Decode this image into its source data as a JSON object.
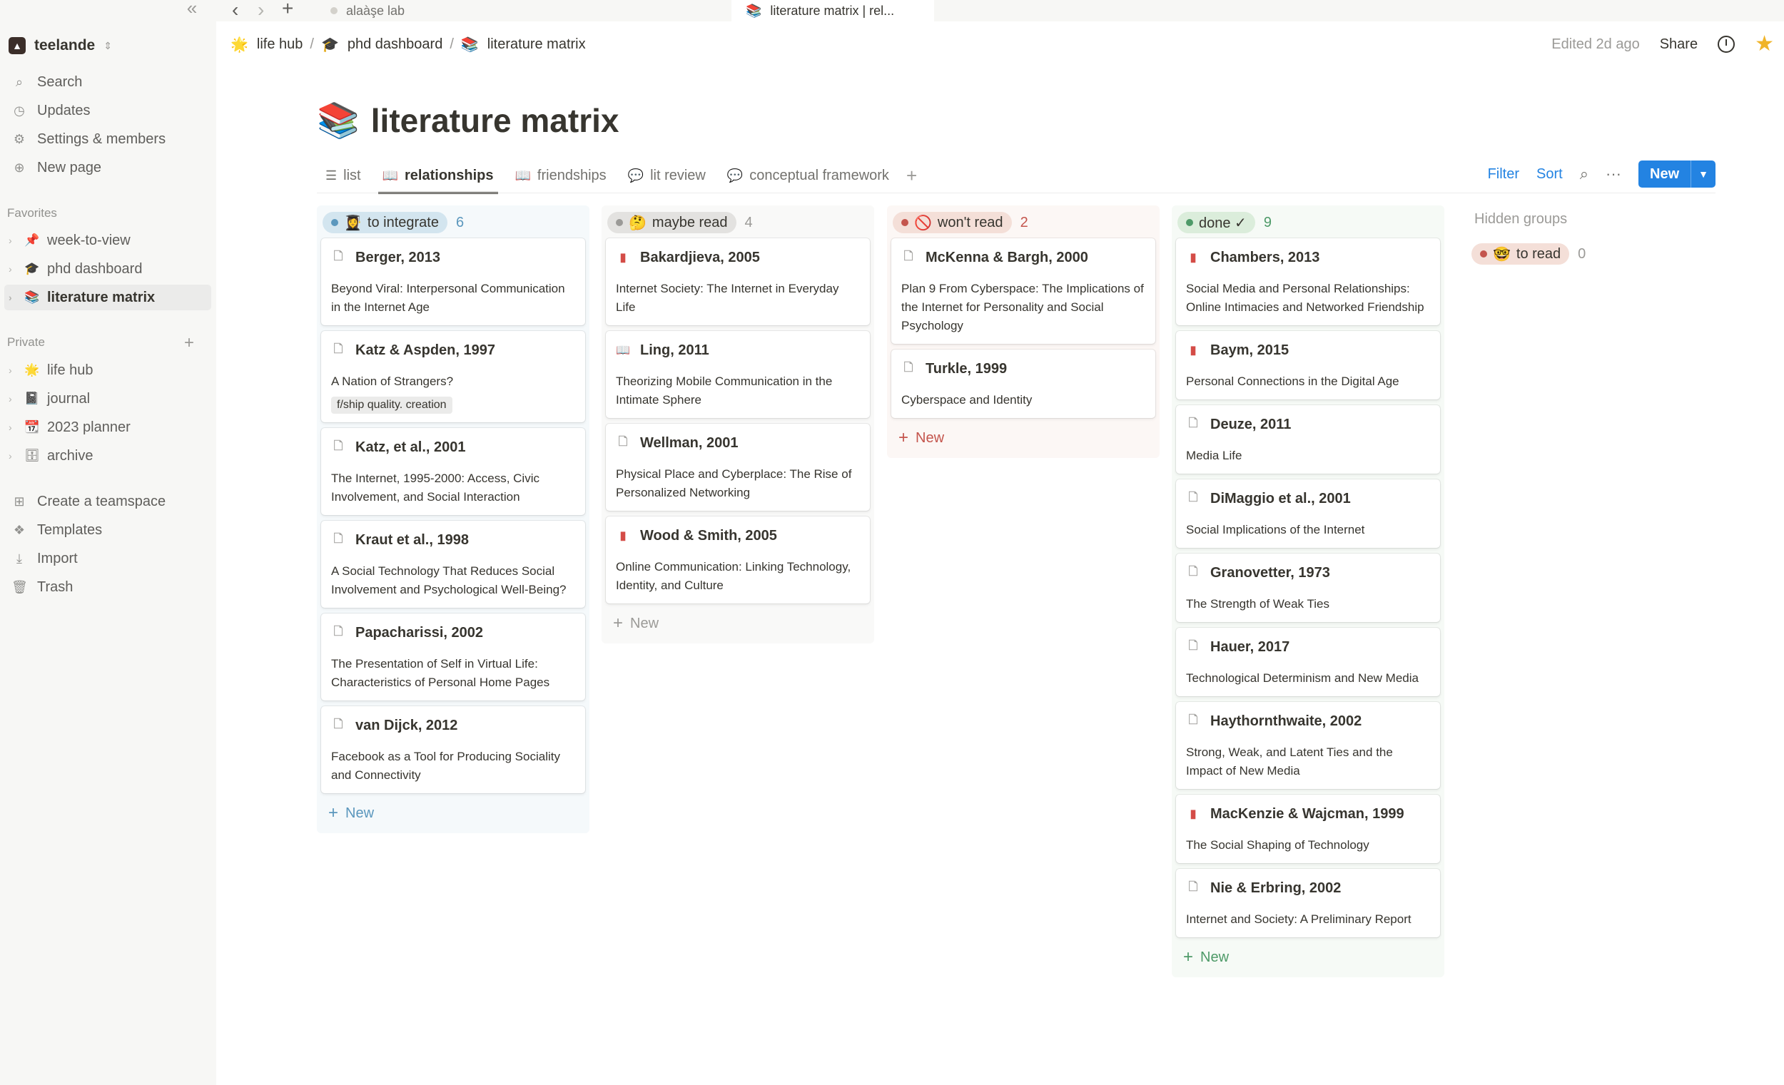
{
  "sidebar": {
    "workspace": {
      "name": "teelande"
    },
    "top_items": [
      {
        "label": "Search",
        "icon": "search-icon",
        "glyph": "⌕"
      },
      {
        "label": "Updates",
        "icon": "clock-icon",
        "glyph": "◷"
      },
      {
        "label": "Settings & members",
        "icon": "gear-icon",
        "glyph": "⚙"
      },
      {
        "label": "New page",
        "icon": "plus-circle-icon",
        "glyph": "⊕"
      }
    ],
    "favorites_label": "Favorites",
    "favorites": [
      {
        "label": "week-to-view",
        "emoji": "📌"
      },
      {
        "label": "phd dashboard",
        "emoji": "🎓"
      },
      {
        "label": "literature matrix",
        "emoji": "📚"
      }
    ],
    "private_label": "Private",
    "private": [
      {
        "label": "life hub",
        "emoji": "🌟"
      },
      {
        "label": "journal",
        "emoji": "📓"
      },
      {
        "label": "2023 planner",
        "emoji": "📆"
      },
      {
        "label": "archive",
        "emoji": "🗄"
      }
    ],
    "bottom_items": [
      {
        "label": "Create a teamspace",
        "icon": "teamspace-icon",
        "glyph": "⊞"
      },
      {
        "label": "Templates",
        "icon": "templates-icon",
        "glyph": "❖"
      },
      {
        "label": "Import",
        "icon": "import-icon",
        "glyph": "⤓"
      },
      {
        "label": "Trash",
        "icon": "trash-icon",
        "glyph": "🗑"
      }
    ]
  },
  "browser": {
    "tabs": [
      {
        "label": "alaàşe lab"
      },
      {
        "label": "literature matrix | rel..."
      }
    ]
  },
  "header": {
    "breadcrumbs": [
      {
        "label": "life hub",
        "emoji": "🌟"
      },
      {
        "label": "phd dashboard",
        "emoji": "🎓"
      },
      {
        "label": "literature matrix",
        "emoji": "📚"
      }
    ],
    "edited": "Edited 2d ago",
    "share": "Share"
  },
  "page": {
    "title": "literature matrix",
    "emoji": "📚"
  },
  "views": [
    {
      "label": "list",
      "glyph": "☰",
      "active": false
    },
    {
      "label": "relationships",
      "glyph": "📖",
      "active": true
    },
    {
      "label": "friendships",
      "glyph": "📖",
      "active": false
    },
    {
      "label": "lit review",
      "glyph": "💬",
      "active": false
    },
    {
      "label": "conceptual framework",
      "glyph": "💬",
      "active": false
    }
  ],
  "toolbar": {
    "filter": "Filter",
    "sort": "Sort",
    "new": "New"
  },
  "board": {
    "new_label": "New",
    "columns": [
      {
        "label": "to integrate",
        "emoji": "👩‍🎓",
        "count": "6",
        "pill_bg": "#d3e5ef",
        "dot": "#5b97bd",
        "col_bg": "#f5f9fb",
        "count_color": "#5b97bd",
        "new_color": "#5b97bd",
        "cards": [
          {
            "title": "Berger, 2013",
            "desc": "Beyond Viral: Interpersonal Communication in the Internet Age",
            "icon": "page"
          },
          {
            "title": "Katz & Aspden, 1997",
            "desc": "A Nation of Strangers?",
            "icon": "page",
            "tag": "f/ship quality. creation"
          },
          {
            "title": "Katz, et al., 2001",
            "desc": "The Internet, 1995-2000: Access, Civic Involvement, and Social Interaction",
            "icon": "page"
          },
          {
            "title": "Kraut et al., 1998",
            "desc": "A Social Technology That Reduces Social Involvement and Psychological Well-Being?",
            "icon": "page"
          },
          {
            "title": "Papacharissi, 2002",
            "desc": "The Presentation of Self in Virtual Life: Characteristics of Personal Home Pages",
            "icon": "page"
          },
          {
            "title": "van Dijck, 2012",
            "desc": "Facebook as a Tool for Producing Sociality and Connectivity",
            "icon": "page"
          }
        ]
      },
      {
        "label": "maybe read",
        "emoji": "🤔",
        "count": "4",
        "pill_bg": "#e3e2e0",
        "dot": "#9b9a97",
        "col_bg": "#f9f9f8",
        "count_color": "#9b9a97",
        "new_color": "#9b9a97",
        "cards": [
          {
            "title": "Bakardjieva, 2005",
            "desc": "Internet Society: The Internet in Everyday Life",
            "icon": "red-book"
          },
          {
            "title": "Ling, 2011",
            "desc": "Theorizing Mobile Communication in the Intimate Sphere",
            "icon": "open-book"
          },
          {
            "title": "Wellman, 2001",
            "desc": "Physical Place and Cyberplace: The Rise of Personalized Networking",
            "icon": "page"
          },
          {
            "title": "Wood & Smith, 2005",
            "desc": "Online Communication: Linking Technology, Identity, and Culture",
            "icon": "red-book"
          }
        ]
      },
      {
        "label": "won't read",
        "emoji": "🚫",
        "count": "2",
        "pill_bg": "#f4dfd8",
        "dot": "#c4554d",
        "col_bg": "#fcf7f5",
        "count_color": "#c4554d",
        "new_color": "#c4554d",
        "cards": [
          {
            "title": "McKenna & Bargh, 2000",
            "desc": "Plan 9 From Cyberspace: The Implications of the Internet for Personality and Social Psychology",
            "icon": "page"
          },
          {
            "title": "Turkle, 1999",
            "desc": "Cyberspace and Identity",
            "icon": "page"
          }
        ]
      },
      {
        "label": "done ✓",
        "emoji": "",
        "count": "9",
        "pill_bg": "#dbeddb",
        "dot": "#4e9a68",
        "col_bg": "#f6faf6",
        "count_color": "#4e9a68",
        "new_color": "#4e9a68",
        "cards": [
          {
            "title": "Chambers, 2013",
            "desc": "Social Media and Personal Relationships: Online Intimacies and Networked Friendship",
            "icon": "red-book"
          },
          {
            "title": "Baym, 2015",
            "desc": "Personal Connections in the Digital Age",
            "icon": "red-book"
          },
          {
            "title": "Deuze, 2011",
            "desc": "Media Life",
            "icon": "page"
          },
          {
            "title": "DiMaggio et al., 2001",
            "desc": "Social Implications of the Internet",
            "icon": "page"
          },
          {
            "title": "Granovetter, 1973",
            "desc": "The Strength of Weak Ties",
            "icon": "page"
          },
          {
            "title": "Hauer, 2017",
            "desc": "Technological Determinism and New Media",
            "icon": "page"
          },
          {
            "title": "Haythornthwaite, 2002",
            "desc": "Strong, Weak, and Latent Ties and the Impact of New Media",
            "icon": "page"
          },
          {
            "title": "MacKenzie & Wajcman, 1999",
            "desc": "The Social Shaping of Technology",
            "icon": "red-book"
          },
          {
            "title": "Nie & Erbring, 2002",
            "desc": "Internet and Society: A Preliminary Report",
            "icon": "page"
          }
        ]
      }
    ],
    "hidden_groups_label": "Hidden groups",
    "hidden": [
      {
        "label": "to read",
        "emoji": "🤓",
        "count": "0",
        "pill_bg": "#f4dfd8",
        "dot": "#c4554d"
      }
    ]
  }
}
